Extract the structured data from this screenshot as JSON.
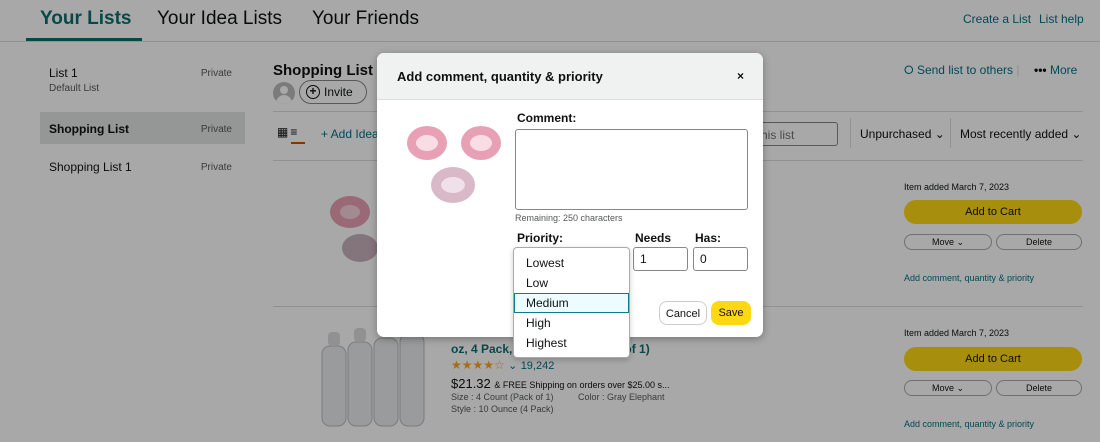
{
  "tabs": [
    "Your Lists",
    "Your Idea Lists",
    "Your Friends"
  ],
  "header_links": {
    "create": "Create a List",
    "help": "List help"
  },
  "sidebar": [
    {
      "name": "List 1",
      "privacy": "Private",
      "sub": "Default List"
    },
    {
      "name": "Shopping List",
      "privacy": "Private",
      "sub": ""
    },
    {
      "name": "Shopping List 1",
      "privacy": "Private",
      "sub": ""
    }
  ],
  "main": {
    "title": "Shopping List",
    "invite": "Invite",
    "add_idea": "+ Add Idea",
    "search_placeholder": "his list",
    "filter": "Unpurchased",
    "sort": "Most recently added",
    "send": "Send list to others",
    "more": "More"
  },
  "items": [
    {
      "added": "Item added March 7, 2023",
      "cart": "Add to Cart",
      "move": "Move",
      "delete": "Delete",
      "comment_link": "Add comment, quantity & priority"
    },
    {
      "added": "Item added March 7, 2023",
      "cart": "Add to Cart",
      "move": "Move",
      "delete": "Delete",
      "comment_link": "Add comment, quantity & priority",
      "title_fragment": "oz, 4 Pack, B",
      "title_fragment2": "k of 1)",
      "rating_count": "19,242",
      "price": "$21.32",
      "shipping": "& FREE Shipping on orders over $25.00 s...",
      "size": "Size : 4 Count (Pack of 1)",
      "color": "Color : Gray Elephant",
      "style": "Style : 10 Ounce (4 Pack)"
    }
  ],
  "modal": {
    "title": "Add comment, quantity & priority",
    "close": "×",
    "comment_label": "Comment:",
    "remaining": "Remaining: 250 characters",
    "priority_label": "Priority:",
    "needs_label": "Needs",
    "has_label": "Has:",
    "needs_value": "1",
    "has_value": "0",
    "cancel": "Cancel",
    "save": "Save"
  },
  "priority_options": [
    "Lowest",
    "Low",
    "Medium",
    "High",
    "Highest"
  ],
  "priority_selected": "Medium"
}
